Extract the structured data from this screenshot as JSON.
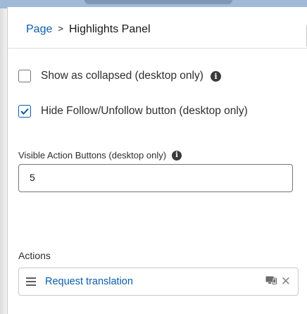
{
  "breadcrumb": {
    "parent": "Page",
    "separator": ">",
    "current": "Highlights Panel"
  },
  "options": {
    "show_collapsed": {
      "label": "Show as collapsed (desktop only)",
      "checked": false
    },
    "hide_follow": {
      "label": "Hide Follow/Unfollow button (desktop only)",
      "checked": true
    }
  },
  "visible_action_buttons": {
    "label": "Visible Action Buttons (desktop only)",
    "value": "5"
  },
  "actions": {
    "section_label": "Actions",
    "items": [
      {
        "label": "Request translation"
      }
    ]
  },
  "icons": {
    "info": "info-icon",
    "checkbox_check": "check-icon",
    "drag": "drag-handle-icon",
    "device": "desktop-phone-icon",
    "remove": "close-icon"
  },
  "colors": {
    "link": "#0b5cab",
    "checkbox_checked": "#0b5cab",
    "border": "#c9c9c9"
  }
}
